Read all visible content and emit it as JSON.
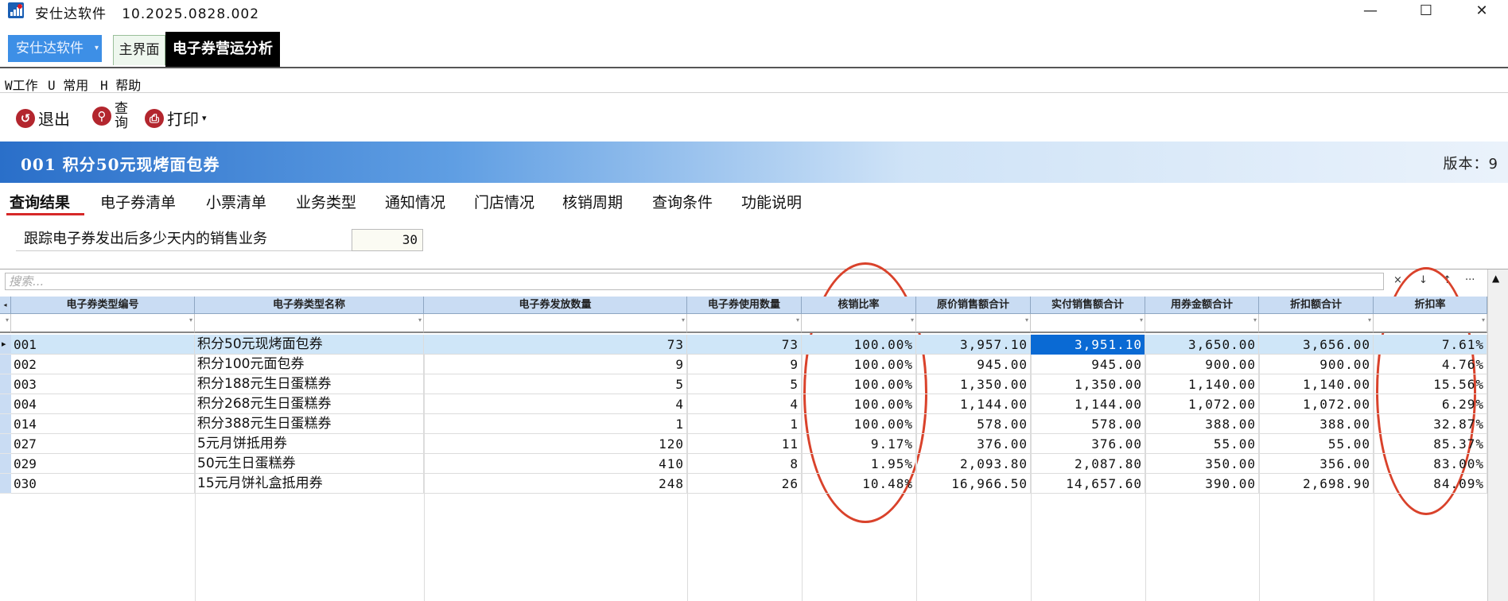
{
  "window": {
    "title": "安仕达软件",
    "version": "10.2025.0828.002",
    "controls": {
      "minimize": "—",
      "maximize": "☐",
      "close": "✕"
    }
  },
  "appbar": {
    "menu_label": "安仕达软件",
    "tabs": [
      {
        "label": "主界面",
        "active": false
      },
      {
        "label": "电子券营运分析",
        "active": true
      }
    ]
  },
  "menubar": {
    "items": [
      {
        "label": "W工作"
      },
      {
        "label": "U 常用"
      },
      {
        "label": "H 帮助"
      }
    ]
  },
  "toolbar": {
    "exit_label": "退出",
    "query_label_top": "查",
    "query_label_bottom": "询",
    "print_label": "打印",
    "print_caret": "▾"
  },
  "header": {
    "title": "001  积分50元现烤面包券",
    "version": "版本：9"
  },
  "subtabs": [
    {
      "label": "查询结果",
      "active": true
    },
    {
      "label": "电子券清单",
      "active": false
    },
    {
      "label": "小票清单",
      "active": false
    },
    {
      "label": "业务类型",
      "active": false
    },
    {
      "label": "通知情况",
      "active": false
    },
    {
      "label": "门店情况",
      "active": false
    },
    {
      "label": "核销周期",
      "active": false
    },
    {
      "label": "查询条件",
      "active": false
    },
    {
      "label": "功能说明",
      "active": false
    }
  ],
  "param": {
    "label": "跟踪电子券发出后多少天内的销售业务",
    "value": "30"
  },
  "grid": {
    "search_placeholder": "搜索...",
    "search_tools": {
      "clear": "×",
      "down": "↓",
      "up": "↑",
      "more": "···"
    },
    "columns": [
      "电子券类型编号",
      "电子券类型名称",
      "电子券发放数量",
      "电子券使用数量",
      "核销比率",
      "原价销售额合计",
      "实付销售额合计",
      "用券金额合计",
      "折扣额合计",
      "折扣率"
    ],
    "rows": [
      [
        "001",
        "积分50元现烤面包券",
        "73",
        "73",
        "100.00%",
        "3,957.10",
        "3,951.10",
        "3,650.00",
        "3,656.00",
        "7.61%"
      ],
      [
        "002",
        "积分100元面包券",
        "9",
        "9",
        "100.00%",
        "945.00",
        "945.00",
        "900.00",
        "900.00",
        "4.76%"
      ],
      [
        "003",
        "积分188元生日蛋糕券",
        "5",
        "5",
        "100.00%",
        "1,350.00",
        "1,350.00",
        "1,140.00",
        "1,140.00",
        "15.56%"
      ],
      [
        "004",
        "积分268元生日蛋糕券",
        "4",
        "4",
        "100.00%",
        "1,144.00",
        "1,144.00",
        "1,072.00",
        "1,072.00",
        "6.29%"
      ],
      [
        "014",
        "积分388元生日蛋糕券",
        "1",
        "1",
        "100.00%",
        "578.00",
        "578.00",
        "388.00",
        "388.00",
        "32.87%"
      ],
      [
        "027",
        "5元月饼抵用券",
        "120",
        "11",
        "9.17%",
        "376.00",
        "376.00",
        "55.00",
        "55.00",
        "85.37%"
      ],
      [
        "029",
        "50元生日蛋糕券",
        "410",
        "8",
        "1.95%",
        "2,093.80",
        "2,087.80",
        "350.00",
        "356.00",
        "83.00%"
      ],
      [
        "030",
        "15元月饼礼盒抵用券",
        "248",
        "26",
        "10.48%",
        "16,966.50",
        "14,657.60",
        "390.00",
        "2,698.90",
        "84.09%"
      ]
    ],
    "selected_row": 0,
    "row_indicator": "▸",
    "scroll_up": "▲"
  },
  "annotations": {
    "color": "#d9422b"
  }
}
